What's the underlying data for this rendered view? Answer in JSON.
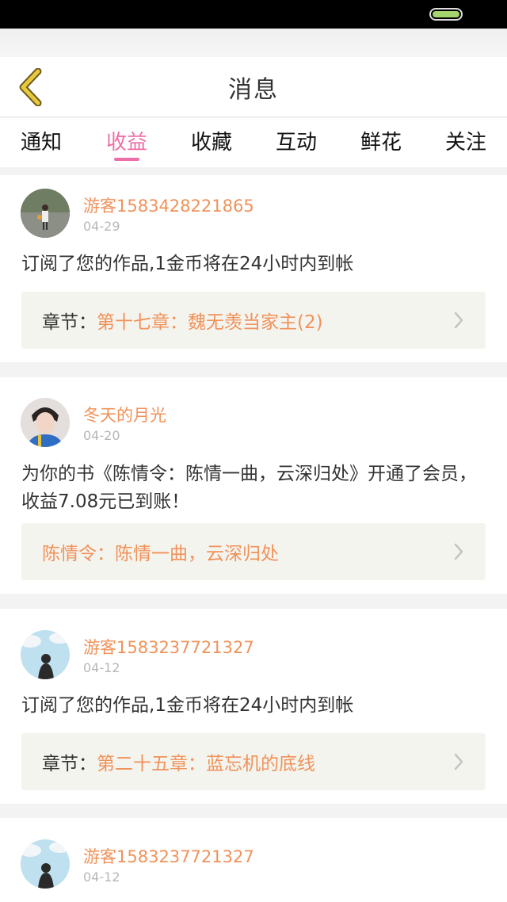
{
  "header": {
    "title": "消息"
  },
  "tabs": [
    {
      "label": "通知"
    },
    {
      "label": "收益"
    },
    {
      "label": "收藏"
    },
    {
      "label": "互动"
    },
    {
      "label": "鲜花"
    },
    {
      "label": "关注"
    }
  ],
  "active_tab": "收益",
  "colors": {
    "accent_pink": "#ee6fa7",
    "accent_orange": "#f0925a",
    "back_arrow": "#e8c83c"
  },
  "messages": [
    {
      "name": "游客1583428221865",
      "date": "04-29",
      "text": "订阅了您的作品,1金币将在24小时内到帐",
      "link_label": "章节：",
      "link_value": "第十七章：魏无羡当家主(2)"
    },
    {
      "name": "冬天的月光",
      "date": "04-20",
      "text": "为你的书《陈情令：陈情一曲，云深归处》开通了会员，收益7.08元已到账！",
      "link_label": "",
      "link_value": "陈情令：陈情一曲，云深归处"
    },
    {
      "name": "游客1583237721327",
      "date": "04-12",
      "text": "订阅了您的作品,1金币将在24小时内到帐",
      "link_label": "章节：",
      "link_value": "第二十五章：蓝忘机的底线"
    },
    {
      "name": "游客1583237721327",
      "date": "04-12"
    }
  ]
}
